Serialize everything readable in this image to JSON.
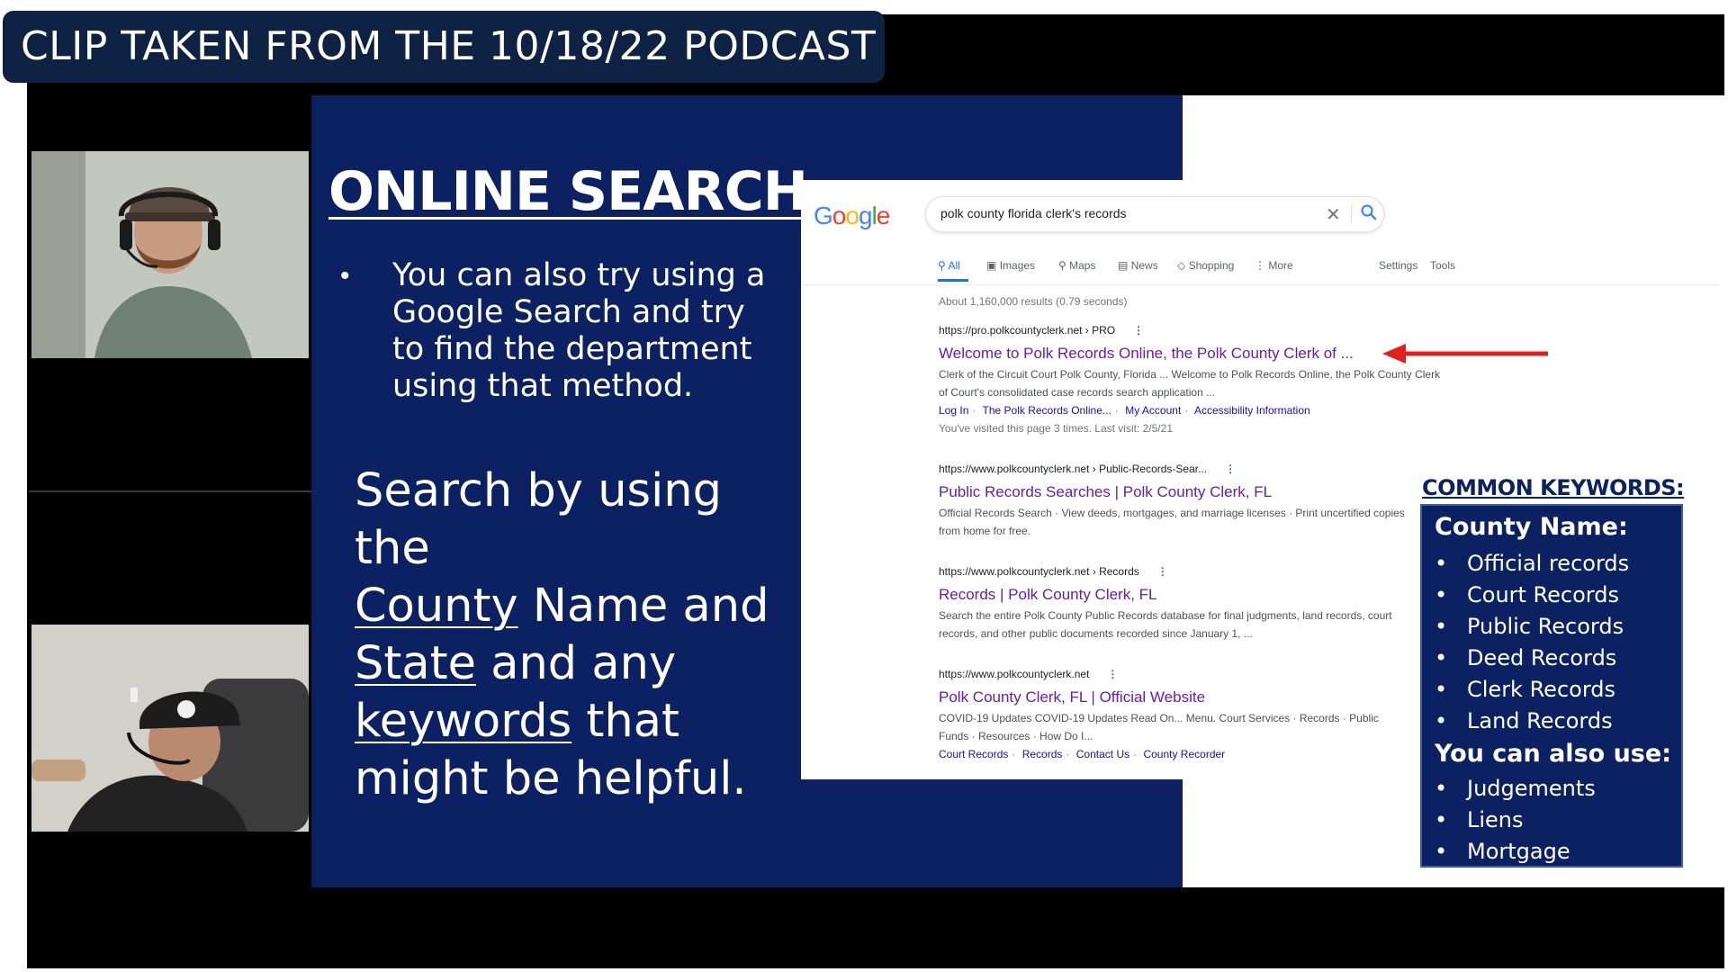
{
  "banner": {
    "text": "CLIP TAKEN FROM THE 10/18/22 PODCAST"
  },
  "slide": {
    "title": "ONLINE SEARCH:",
    "bullet": "You can also try using a Google Search and try to find the department using that method.",
    "search_para": {
      "p1": "Search by using the",
      "county": "County",
      "p2": " Name and",
      "state": "State",
      "p3": " and any",
      "keywords": "keywords",
      "p4": " that might be helpful."
    }
  },
  "google": {
    "logo": "Google",
    "query": "polk county florida clerk's records",
    "clear_glyph": "✕",
    "tabs": [
      "All",
      "Images",
      "Maps",
      "News",
      "Shopping",
      "More"
    ],
    "tools": [
      "Settings",
      "Tools"
    ],
    "stats": "About 1,160,000 results (0.79 seconds)",
    "results": [
      {
        "url": "https://pro.polkcountyclerk.net › PRO",
        "title": "Welcome to Polk Records Online, the Polk County Clerk of ...",
        "snippet": "Clerk of the Circuit Court Polk County, Florida ... Welcome to Polk Records Online, the Polk County Clerk of Court's consolidated case records search application ...",
        "links": [
          "Log In",
          "The Polk Records Online...",
          "My Account",
          "Accessibility Information"
        ],
        "visited": "You've visited this page 3 times. Last visit: 2/5/21"
      },
      {
        "url": "https://www.polkcountyclerk.net › Public-Records-Sear...",
        "title": "Public Records Searches | Polk County Clerk, FL",
        "snippet": "Official Records Search · View deeds, mortgages, and marriage licenses · Print uncertified copies from home for free."
      },
      {
        "url": "https://www.polkcountyclerk.net › Records",
        "title": "Records | Polk County Clerk, FL",
        "snippet": "Search the entire Polk County Public Records database for final judgments, land records, court records, and other public documents recorded since January 1, ..."
      },
      {
        "url": "https://www.polkcountyclerk.net",
        "title": "Polk County Clerk, FL | Official Website",
        "snippet": "COVID-19 Updates COVID-19 Updates Read On... Menu. Court Services · Records · Public Funds · Resources · How Do I...",
        "links": [
          "Court Records",
          "Records",
          "Contact Us",
          "County Recorder"
        ]
      }
    ]
  },
  "keywords": {
    "heading": "COMMON KEYWORDS:",
    "county_label": "County Name:",
    "county_items": [
      "Official records",
      "Court Records",
      "Public Records",
      "Deed Records",
      "Clerk Records",
      "Land Records"
    ],
    "also_label": "You can also use:",
    "also_items": [
      "Judgements",
      "Liens",
      "Mortgage"
    ],
    "bullet_glyph": "•"
  },
  "colors": {
    "slide_blue": "#0c2161",
    "banner": "#0e2244",
    "arrow": "#e02020",
    "google_link": "#1a0dab",
    "google_visited": "#681da8"
  }
}
